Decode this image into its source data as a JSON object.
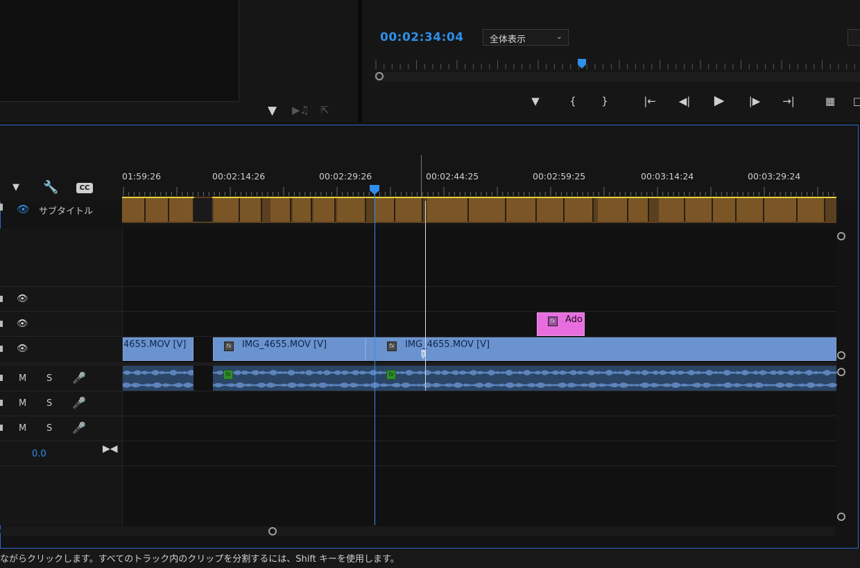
{
  "program_monitor": {
    "timecode": "00:02:34:04",
    "fit_select": "全体表示",
    "transport": [
      "marker-icon",
      "mark-in-icon",
      "mark-out-icon",
      "go-to-in-icon",
      "step-back-icon",
      "play-icon",
      "step-forward-icon",
      "go-to-out-icon",
      "lift-icon"
    ]
  },
  "timeline": {
    "ruler_labels": [
      "01:59:26",
      "00:02:14:26",
      "00:02:29:26",
      "00:02:44:25",
      "00:02:59:25",
      "00:03:14:24",
      "00:03:29:24"
    ],
    "subtitle_track_label": "サブタイトル",
    "audio_header": {
      "m": "M",
      "s": "S"
    },
    "master_volume": "0.0",
    "clips": [
      {
        "label": "4655.MOV [V]"
      },
      {
        "label": "IMG_4655.MOV [V]"
      },
      {
        "label": "IMG_4655.MOV [V]"
      },
      {
        "label": "Ado"
      }
    ],
    "fx": "fx"
  },
  "status_bar": {
    "text": "ながらクリックします。すべてのトラック内のクリップを分割するには、Shift キーを使用します。"
  },
  "colors": {
    "accent": "#2f8fea",
    "clip_video": "#6a93cf",
    "clip_pink": "#e86ee0",
    "subtitle": "#7a5627"
  }
}
